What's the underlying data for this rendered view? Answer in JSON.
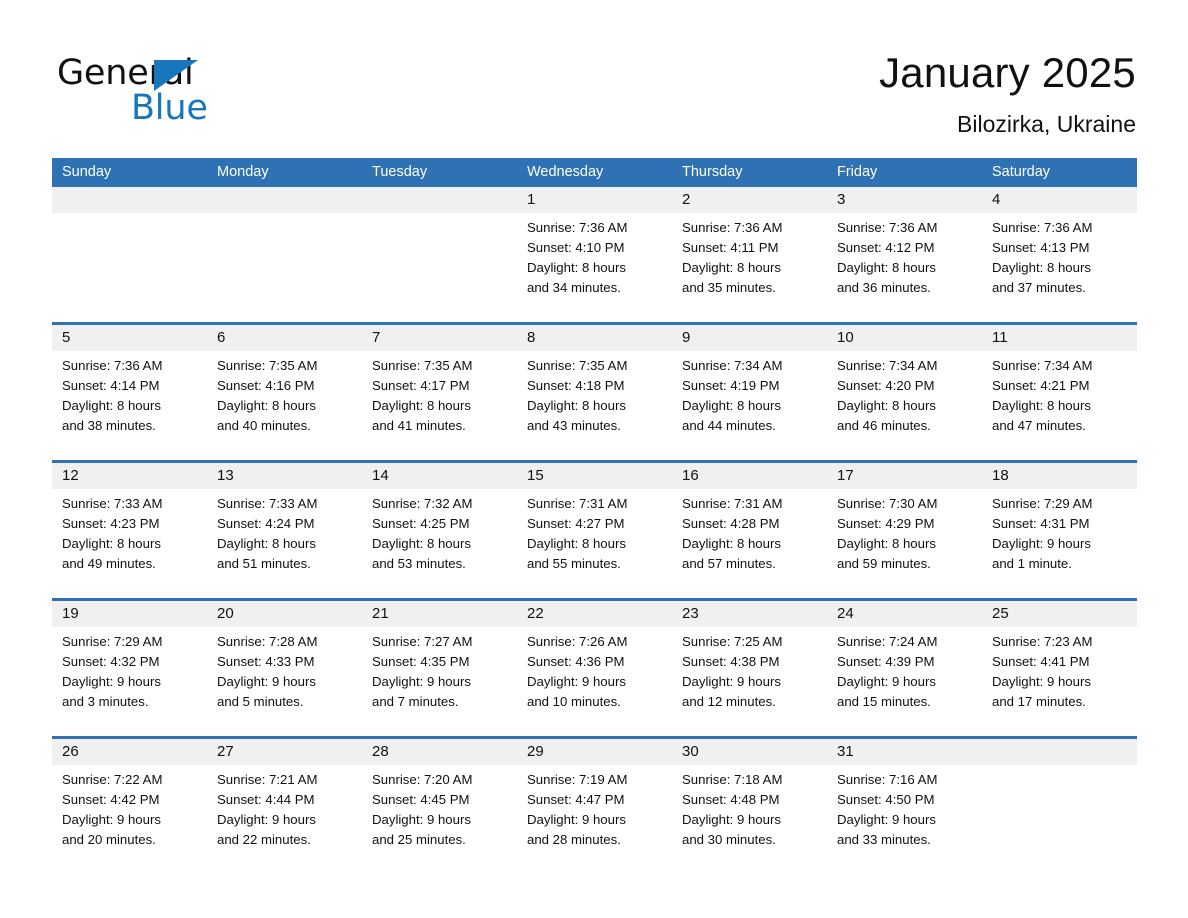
{
  "brand": {
    "name_dark": "General",
    "name_blue": "Blue",
    "triangle_color": "#1876bd"
  },
  "header": {
    "title": "January 2025",
    "location": "Bilozirka, Ukraine"
  },
  "theme": {
    "header_blue": "#2e72b3",
    "row_divider_blue": "#2e72b3",
    "daynum_band": "#f0f0f0",
    "text": "#111111"
  },
  "weekdays": [
    "Sunday",
    "Monday",
    "Tuesday",
    "Wednesday",
    "Thursday",
    "Friday",
    "Saturday"
  ],
  "weeks": [
    [
      {
        "day": "",
        "l1": "",
        "l2": "",
        "l3": "",
        "l4": ""
      },
      {
        "day": "",
        "l1": "",
        "l2": "",
        "l3": "",
        "l4": ""
      },
      {
        "day": "",
        "l1": "",
        "l2": "",
        "l3": "",
        "l4": ""
      },
      {
        "day": "1",
        "l1": "Sunrise: 7:36 AM",
        "l2": "Sunset: 4:10 PM",
        "l3": "Daylight: 8 hours",
        "l4": "and 34 minutes."
      },
      {
        "day": "2",
        "l1": "Sunrise: 7:36 AM",
        "l2": "Sunset: 4:11 PM",
        "l3": "Daylight: 8 hours",
        "l4": "and 35 minutes."
      },
      {
        "day": "3",
        "l1": "Sunrise: 7:36 AM",
        "l2": "Sunset: 4:12 PM",
        "l3": "Daylight: 8 hours",
        "l4": "and 36 minutes."
      },
      {
        "day": "4",
        "l1": "Sunrise: 7:36 AM",
        "l2": "Sunset: 4:13 PM",
        "l3": "Daylight: 8 hours",
        "l4": "and 37 minutes."
      }
    ],
    [
      {
        "day": "5",
        "l1": "Sunrise: 7:36 AM",
        "l2": "Sunset: 4:14 PM",
        "l3": "Daylight: 8 hours",
        "l4": "and 38 minutes."
      },
      {
        "day": "6",
        "l1": "Sunrise: 7:35 AM",
        "l2": "Sunset: 4:16 PM",
        "l3": "Daylight: 8 hours",
        "l4": "and 40 minutes."
      },
      {
        "day": "7",
        "l1": "Sunrise: 7:35 AM",
        "l2": "Sunset: 4:17 PM",
        "l3": "Daylight: 8 hours",
        "l4": "and 41 minutes."
      },
      {
        "day": "8",
        "l1": "Sunrise: 7:35 AM",
        "l2": "Sunset: 4:18 PM",
        "l3": "Daylight: 8 hours",
        "l4": "and 43 minutes."
      },
      {
        "day": "9",
        "l1": "Sunrise: 7:34 AM",
        "l2": "Sunset: 4:19 PM",
        "l3": "Daylight: 8 hours",
        "l4": "and 44 minutes."
      },
      {
        "day": "10",
        "l1": "Sunrise: 7:34 AM",
        "l2": "Sunset: 4:20 PM",
        "l3": "Daylight: 8 hours",
        "l4": "and 46 minutes."
      },
      {
        "day": "11",
        "l1": "Sunrise: 7:34 AM",
        "l2": "Sunset: 4:21 PM",
        "l3": "Daylight: 8 hours",
        "l4": "and 47 minutes."
      }
    ],
    [
      {
        "day": "12",
        "l1": "Sunrise: 7:33 AM",
        "l2": "Sunset: 4:23 PM",
        "l3": "Daylight: 8 hours",
        "l4": "and 49 minutes."
      },
      {
        "day": "13",
        "l1": "Sunrise: 7:33 AM",
        "l2": "Sunset: 4:24 PM",
        "l3": "Daylight: 8 hours",
        "l4": "and 51 minutes."
      },
      {
        "day": "14",
        "l1": "Sunrise: 7:32 AM",
        "l2": "Sunset: 4:25 PM",
        "l3": "Daylight: 8 hours",
        "l4": "and 53 minutes."
      },
      {
        "day": "15",
        "l1": "Sunrise: 7:31 AM",
        "l2": "Sunset: 4:27 PM",
        "l3": "Daylight: 8 hours",
        "l4": "and 55 minutes."
      },
      {
        "day": "16",
        "l1": "Sunrise: 7:31 AM",
        "l2": "Sunset: 4:28 PM",
        "l3": "Daylight: 8 hours",
        "l4": "and 57 minutes."
      },
      {
        "day": "17",
        "l1": "Sunrise: 7:30 AM",
        "l2": "Sunset: 4:29 PM",
        "l3": "Daylight: 8 hours",
        "l4": "and 59 minutes."
      },
      {
        "day": "18",
        "l1": "Sunrise: 7:29 AM",
        "l2": "Sunset: 4:31 PM",
        "l3": "Daylight: 9 hours",
        "l4": "and 1 minute."
      }
    ],
    [
      {
        "day": "19",
        "l1": "Sunrise: 7:29 AM",
        "l2": "Sunset: 4:32 PM",
        "l3": "Daylight: 9 hours",
        "l4": "and 3 minutes."
      },
      {
        "day": "20",
        "l1": "Sunrise: 7:28 AM",
        "l2": "Sunset: 4:33 PM",
        "l3": "Daylight: 9 hours",
        "l4": "and 5 minutes."
      },
      {
        "day": "21",
        "l1": "Sunrise: 7:27 AM",
        "l2": "Sunset: 4:35 PM",
        "l3": "Daylight: 9 hours",
        "l4": "and 7 minutes."
      },
      {
        "day": "22",
        "l1": "Sunrise: 7:26 AM",
        "l2": "Sunset: 4:36 PM",
        "l3": "Daylight: 9 hours",
        "l4": "and 10 minutes."
      },
      {
        "day": "23",
        "l1": "Sunrise: 7:25 AM",
        "l2": "Sunset: 4:38 PM",
        "l3": "Daylight: 9 hours",
        "l4": "and 12 minutes."
      },
      {
        "day": "24",
        "l1": "Sunrise: 7:24 AM",
        "l2": "Sunset: 4:39 PM",
        "l3": "Daylight: 9 hours",
        "l4": "and 15 minutes."
      },
      {
        "day": "25",
        "l1": "Sunrise: 7:23 AM",
        "l2": "Sunset: 4:41 PM",
        "l3": "Daylight: 9 hours",
        "l4": "and 17 minutes."
      }
    ],
    [
      {
        "day": "26",
        "l1": "Sunrise: 7:22 AM",
        "l2": "Sunset: 4:42 PM",
        "l3": "Daylight: 9 hours",
        "l4": "and 20 minutes."
      },
      {
        "day": "27",
        "l1": "Sunrise: 7:21 AM",
        "l2": "Sunset: 4:44 PM",
        "l3": "Daylight: 9 hours",
        "l4": "and 22 minutes."
      },
      {
        "day": "28",
        "l1": "Sunrise: 7:20 AM",
        "l2": "Sunset: 4:45 PM",
        "l3": "Daylight: 9 hours",
        "l4": "and 25 minutes."
      },
      {
        "day": "29",
        "l1": "Sunrise: 7:19 AM",
        "l2": "Sunset: 4:47 PM",
        "l3": "Daylight: 9 hours",
        "l4": "and 28 minutes."
      },
      {
        "day": "30",
        "l1": "Sunrise: 7:18 AM",
        "l2": "Sunset: 4:48 PM",
        "l3": "Daylight: 9 hours",
        "l4": "and 30 minutes."
      },
      {
        "day": "31",
        "l1": "Sunrise: 7:16 AM",
        "l2": "Sunset: 4:50 PM",
        "l3": "Daylight: 9 hours",
        "l4": "and 33 minutes."
      },
      {
        "day": "",
        "l1": "",
        "l2": "",
        "l3": "",
        "l4": ""
      }
    ]
  ]
}
